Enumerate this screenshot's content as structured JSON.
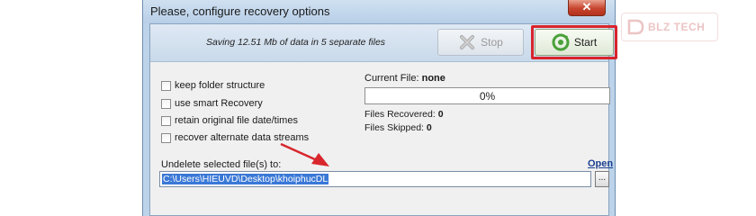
{
  "window": {
    "title": "Please, configure recovery options",
    "close_label": "✕"
  },
  "header": {
    "saving_text": "Saving 12.51 Mb of data in 5 separate files",
    "stop_label": "Stop",
    "stop_icon": "stop-x-icon",
    "start_label": "Start",
    "start_icon": "start-refresh-icon",
    "highlight_color": "#d9242c"
  },
  "options": [
    {
      "label": "keep folder structure",
      "checked": false
    },
    {
      "label": "use smart Recovery",
      "checked": false
    },
    {
      "label": "retain original file date/times",
      "checked": false
    },
    {
      "label": "recover alternate data streams",
      "checked": false
    }
  ],
  "status": {
    "current_file_label": "Current File:",
    "current_file_value": "none",
    "progress_text": "0%",
    "progress_value": 0,
    "recovered_label": "Files Recovered:",
    "recovered_value": "0",
    "skipped_label": "Files Skipped:",
    "skipped_value": "0"
  },
  "destination": {
    "label": "Undelete selected file(s) to:",
    "open_link": "Open",
    "path": "C:\\Users\\HIEUVD\\Desktop\\khoiphucDL",
    "browse_label": "..."
  },
  "watermark": {
    "text": "BLZ TECH"
  }
}
